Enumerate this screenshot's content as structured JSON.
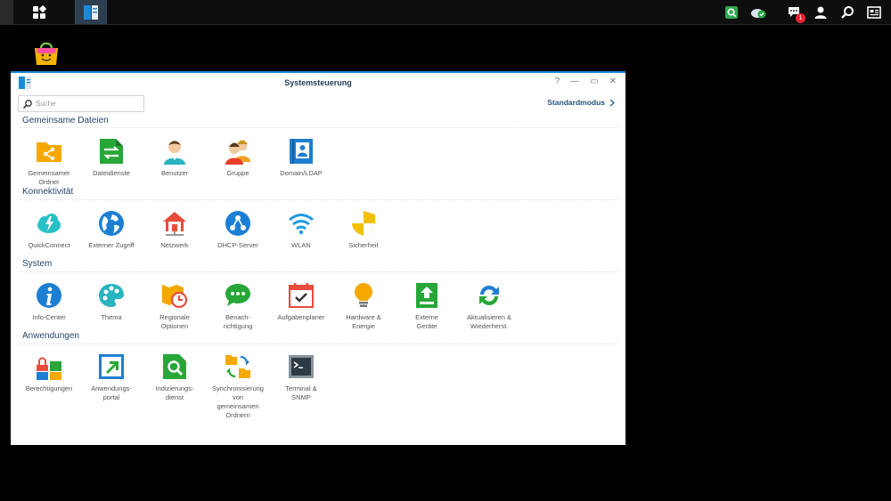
{
  "window": {
    "title": "Systemsteuerung",
    "controls": [
      "?",
      "—",
      "▭",
      "✕"
    ]
  },
  "toolbar": {
    "search_placeholder": "Suche",
    "mode_label": "Standardmodus"
  },
  "sections": [
    {
      "title": "Gemeinsame Dateien",
      "items": [
        {
          "label": "Gemeinsamer\nOrdner",
          "icon": "shared-folder-icon"
        },
        {
          "label": "Dateidienste",
          "icon": "file-services-icon"
        },
        {
          "label": "Benutzer",
          "icon": "user-icon"
        },
        {
          "label": "Gruppe",
          "icon": "group-icon"
        },
        {
          "label": "Domain/LDAP",
          "icon": "domain-ldap-icon"
        }
      ]
    },
    {
      "title": "Konnektivität",
      "items": [
        {
          "label": "QuickConnect",
          "icon": "quickconnect-icon"
        },
        {
          "label": "Externer Zugriff",
          "icon": "globe-icon"
        },
        {
          "label": "Netzwerk",
          "icon": "network-icon"
        },
        {
          "label": "DHCP-Server",
          "icon": "dhcp-server-icon"
        },
        {
          "label": "WLAN",
          "icon": "wifi-icon"
        },
        {
          "label": "Sicherheit",
          "icon": "shield-icon"
        }
      ]
    },
    {
      "title": "System",
      "items": [
        {
          "label": "Info-Center",
          "icon": "info-icon"
        },
        {
          "label": "Thema",
          "icon": "palette-icon"
        },
        {
          "label": "Regionale\nOptionen",
          "icon": "regional-options-icon"
        },
        {
          "label": "Benach-\nrichtigung",
          "icon": "notification-icon"
        },
        {
          "label": "Aufgabenplaner",
          "icon": "task-scheduler-icon"
        },
        {
          "label": "Hardware &\nEnergie",
          "icon": "lightbulb-icon"
        },
        {
          "label": "Externe\nGeräte",
          "icon": "external-devices-icon"
        },
        {
          "label": "Aktualisieren &\nWiederherst.",
          "icon": "refresh-icon"
        }
      ]
    },
    {
      "title": "Anwendungen",
      "items": [
        {
          "label": "Berechtigungen",
          "icon": "privileges-icon"
        },
        {
          "label": "Anwendungs-\nportal",
          "icon": "app-portal-icon"
        },
        {
          "label": "Indizierungs-\ndienst",
          "icon": "indexing-service-icon"
        },
        {
          "label": "Synchronisierung\nvon\ngemeinsamen\nOrdnern",
          "icon": "folder-sync-icon"
        },
        {
          "label": "Terminal &\nSNMP",
          "icon": "terminal-icon"
        }
      ]
    }
  ],
  "taskbar": {
    "notification_count": "1",
    "right_icons": [
      "search-app-icon",
      "cloud-sync-icon",
      "chat-icon",
      "user-account-icon",
      "search-icon",
      "widgets-icon"
    ]
  }
}
